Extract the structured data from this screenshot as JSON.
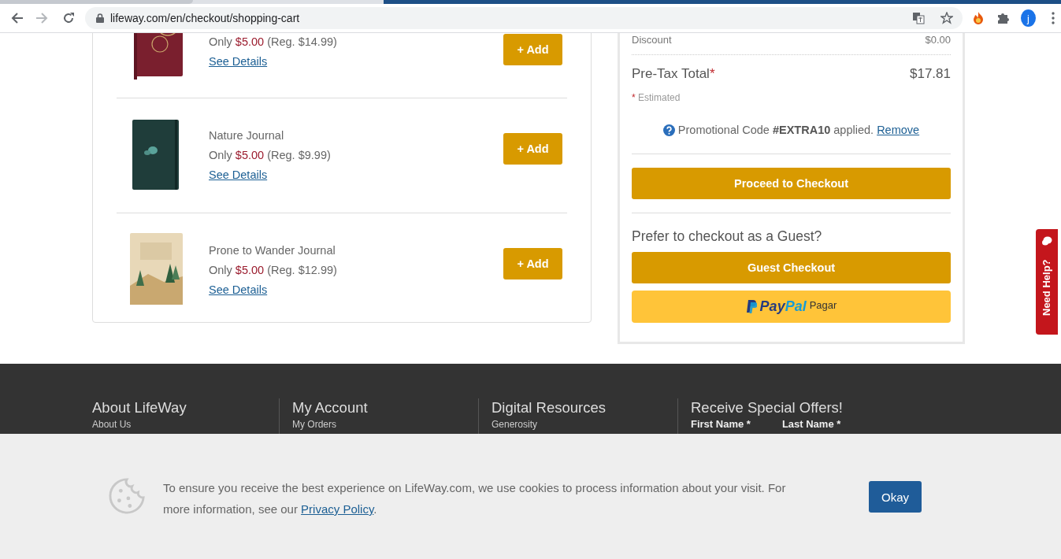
{
  "browser": {
    "url": "lifeway.com/en/checkout/shopping-cart",
    "avatar": "j"
  },
  "offers": [
    {
      "price_prefix": "Only",
      "price": "$5.00",
      "regular": "(Reg. $14.99)",
      "link": "See Details",
      "button": "+ Add"
    },
    {
      "name": "Nature Journal",
      "price_prefix": "Only",
      "price": "$5.00",
      "regular": "(Reg. $9.99)",
      "link": "See Details",
      "button": "+ Add"
    },
    {
      "name": "Prone to Wander Journal",
      "price_prefix": "Only",
      "price": "$5.00",
      "regular": "(Reg. $12.99)",
      "link": "See Details",
      "button": "+ Add"
    }
  ],
  "summary": {
    "discount": {
      "label": "Discount",
      "value": "$0.00"
    },
    "pretax": {
      "label": "Pre-Tax Total",
      "mark": "*",
      "value": "$17.81"
    },
    "estimated": {
      "mark": "*",
      "text": "Estimated"
    },
    "promo": {
      "text": "Promotional Code **#EXTRA10** applied.",
      "link": "Remove"
    },
    "checkout_button": "Proceed to Checkout",
    "guest_prompt": "Prefer to checkout as a Guest?",
    "guest_button": "Guest Checkout",
    "paypal": {
      "brand_pay": "Pay",
      "brand_pal": "Pal",
      "caption": "Pagar"
    }
  },
  "footer": [
    {
      "heading": "About LifeWay",
      "links": [
        "About Us"
      ]
    },
    {
      "heading": "My Account",
      "links": [
        "My Orders"
      ]
    },
    {
      "heading": "Digital Resources",
      "links": [
        "Generosity"
      ]
    },
    {
      "heading": "Receive Special Offers!",
      "fields": [
        "First Name *",
        "Last Name *"
      ]
    }
  ],
  "cookie": {
    "text": "To ensure you receive the best experience on LifeWay.com, we use cookies to process information about your visit. For more information, see our",
    "link": "Privacy Policy",
    "after": ".",
    "button": "Okay"
  },
  "help": {
    "label": "Need Help?"
  }
}
